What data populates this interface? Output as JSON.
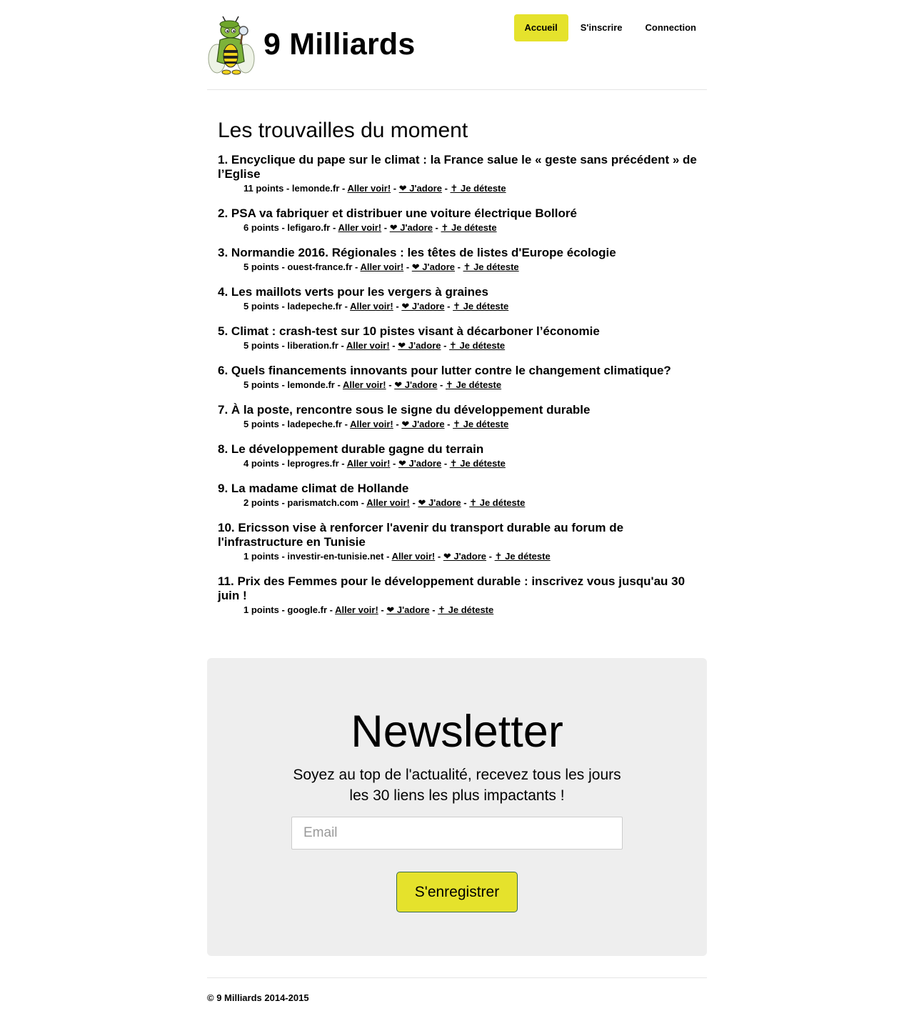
{
  "brand": {
    "name": "9 Milliards",
    "logo_icon": "bee-mascot-icon"
  },
  "nav": {
    "items": [
      {
        "label": "Accueil",
        "active": true
      },
      {
        "label": "S'inscrire",
        "active": false
      },
      {
        "label": "Connection",
        "active": false
      }
    ]
  },
  "main": {
    "title": "Les trouvailles du moment",
    "link_labels": {
      "go": "Aller voir!",
      "love": "❤ J'adore",
      "hate": "✝ Je déteste"
    },
    "items": [
      {
        "rank": "1.",
        "title": "Encyclique du pape sur le climat : la France salue le « geste sans précédent » de l’Eglise",
        "points": "11 points",
        "domain": "lemonde.fr"
      },
      {
        "rank": "2.",
        "title": "PSA va fabriquer et distribuer une voiture électrique Bolloré",
        "points": "6 points",
        "domain": "lefigaro.fr"
      },
      {
        "rank": "3.",
        "title": "Normandie 2016. Régionales : les têtes de listes d'Europe écologie",
        "points": "5 points",
        "domain": "ouest-france.fr"
      },
      {
        "rank": "4.",
        "title": "Les maillots verts pour les vergers à graines",
        "points": "5 points",
        "domain": "ladepeche.fr"
      },
      {
        "rank": "5.",
        "title": "Climat : crash-test sur 10 pistes visant à décarboner l’économie",
        "points": "5 points",
        "domain": "liberation.fr"
      },
      {
        "rank": "6.",
        "title": "Quels financements innovants pour lutter contre le changement climatique?",
        "points": "5 points",
        "domain": "lemonde.fr"
      },
      {
        "rank": "7.",
        "title": "À la poste, rencontre sous le signe du développement durable",
        "points": "5 points",
        "domain": "ladepeche.fr"
      },
      {
        "rank": "8.",
        "title": "Le développement durable gagne du terrain",
        "points": "4 points",
        "domain": "leprogres.fr"
      },
      {
        "rank": "9.",
        "title": "La madame climat de Hollande",
        "points": "2 points",
        "domain": "parismatch.com"
      },
      {
        "rank": "10.",
        "title": "Ericsson vise à renforcer l'avenir du transport durable au forum de l'infrastructure en Tunisie",
        "points": "1 points",
        "domain": "investir-en-tunisie.net"
      },
      {
        "rank": "11.",
        "title": "Prix des Femmes pour le développement durable : inscrivez vous jusqu'au 30 juin !",
        "points": "1 points",
        "domain": "google.fr"
      }
    ]
  },
  "newsletter": {
    "title": "Newsletter",
    "text": "Soyez au top de l'actualité, recevez tous les jours les 30 liens les plus impactants !",
    "email_placeholder": "Email",
    "email_value": "",
    "button_label": "S'enregistrer"
  },
  "footer": {
    "text": "© 9 Milliards 2014-2015"
  },
  "colors": {
    "accent": "#e5e22c",
    "jumbotron_bg": "#eeeeee",
    "divider": "#e5e5e5"
  }
}
